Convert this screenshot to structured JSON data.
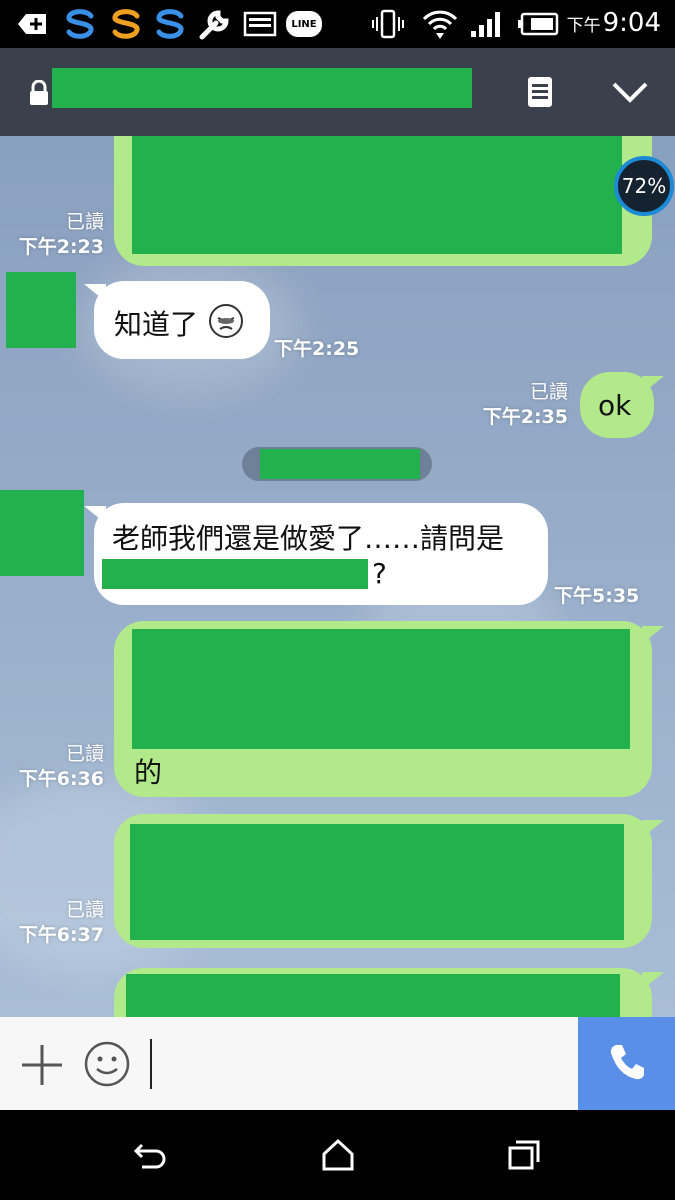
{
  "status_bar": {
    "time_prefix": "下午",
    "time": "9:04",
    "icons": [
      "add-box-icon",
      "sync-blue-icon",
      "sync-orange-icon",
      "sync-blue-icon",
      "wrench-icon",
      "image-icon",
      "line-app-icon",
      "vibrate-icon",
      "wifi-icon",
      "signal-icon",
      "battery-icon"
    ],
    "line_label": "LINE"
  },
  "header": {
    "title_redacted": true,
    "icons": [
      "lock-icon",
      "notes-icon",
      "chevron-down-icon"
    ]
  },
  "floating_badge": {
    "label": "72%"
  },
  "messages": [
    {
      "direction": "out",
      "read": "已讀",
      "time": "下午2:23",
      "redacted": true
    },
    {
      "direction": "in",
      "text": "知道了",
      "emoji": "sad-face-emoji",
      "time": "下午2:25"
    },
    {
      "direction": "out",
      "read": "已讀",
      "time": "下午2:35",
      "text": "ok"
    },
    {
      "direction": "in",
      "text": "老師我們還是做愛了……請問是",
      "text_suffix": "?",
      "time": "下午5:35"
    },
    {
      "direction": "out",
      "read": "已讀",
      "time": "下午6:36",
      "text": "的",
      "redacted": true
    },
    {
      "direction": "out",
      "read": "已讀",
      "time": "下午6:37",
      "redacted": true
    },
    {
      "direction": "out",
      "redacted": true
    }
  ],
  "input_bar": {
    "icons": [
      "plus-icon",
      "emoji-icon",
      "phone-icon"
    ],
    "value": ""
  },
  "nav_bar": {
    "icons": [
      "back-icon",
      "home-icon",
      "recents-icon"
    ]
  },
  "colors": {
    "outgoing_bubble": "#b2ea8b",
    "incoming_bubble": "#ffffff",
    "header_bg": "#3a404c",
    "call_button": "#5a8fe8",
    "redaction": "#22b14c"
  }
}
